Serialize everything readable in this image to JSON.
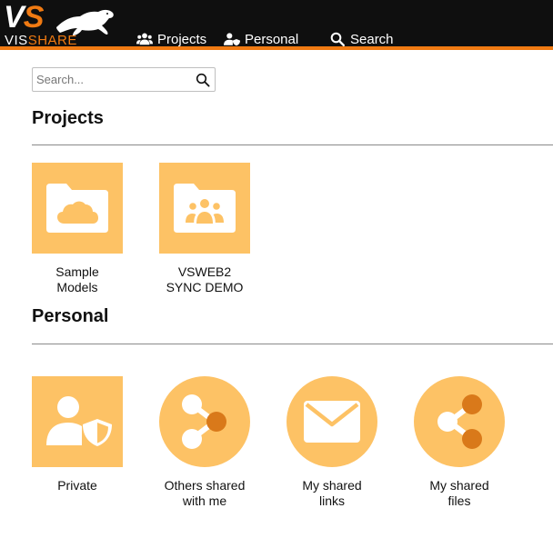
{
  "brand": {
    "logo_letters_v": "V",
    "logo_letters_s": "S",
    "wordmark_vis": "VIS",
    "wordmark_share": "SHARE",
    "accent_color": "#f07a12",
    "tile_color": "#fdc265",
    "tile_icon_color": "#d9791a"
  },
  "nav": {
    "projects": "Projects",
    "personal": "Personal",
    "search": "Search"
  },
  "search": {
    "placeholder": "Search..."
  },
  "sections": {
    "projects": {
      "title": "Projects",
      "tiles": [
        {
          "label_line1": "Sample",
          "label_line2": "Models",
          "icon": "cloud-folder-icon"
        },
        {
          "label_line1": "VSWEB2",
          "label_line2": "SYNC DEMO",
          "icon": "group-folder-icon"
        }
      ]
    },
    "personal": {
      "title": "Personal",
      "tiles": [
        {
          "label_line1": "Private",
          "label_line2": "",
          "icon": "user-shield-icon"
        },
        {
          "label_line1": "Others shared",
          "label_line2": "with me",
          "icon": "share-incoming-icon"
        },
        {
          "label_line1": "My shared",
          "label_line2": "links",
          "icon": "envelope-icon"
        },
        {
          "label_line1": "My shared",
          "label_line2": "files",
          "icon": "share-outgoing-icon"
        }
      ]
    }
  }
}
